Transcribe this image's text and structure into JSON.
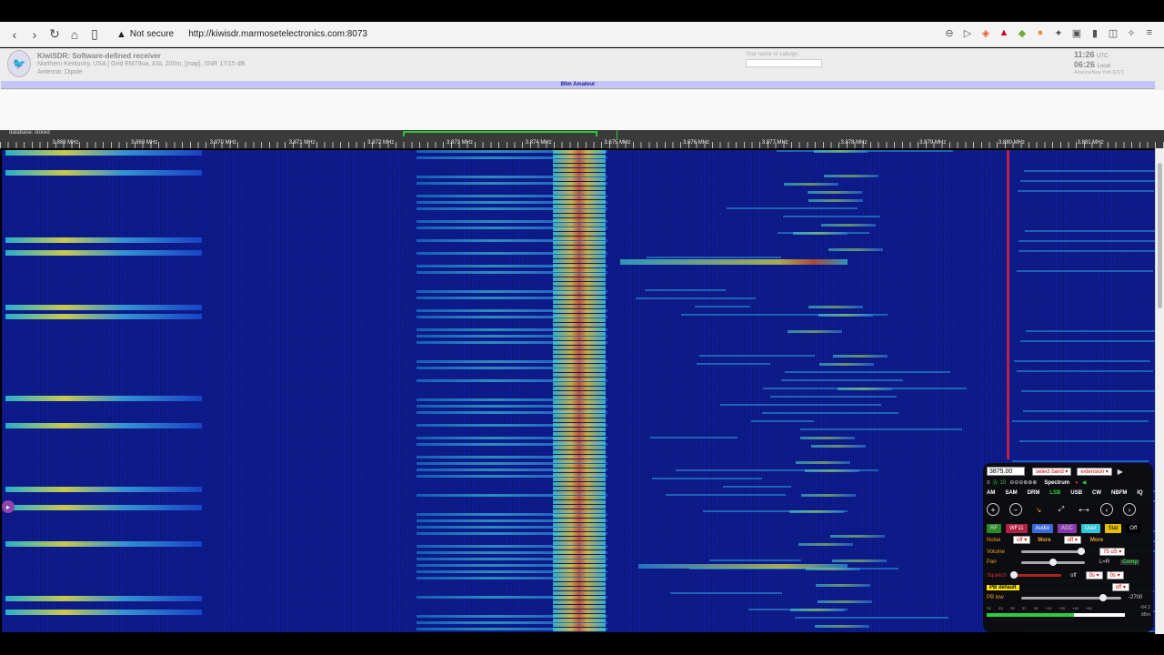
{
  "browser": {
    "security_label": "Not secure",
    "url": "http://kiwisdr.marmosetelectronics.com:8073"
  },
  "header": {
    "title": "KiwiSDR: Software-defined receiver",
    "location": "Northern Kentucky, USA | Grid EM79ua, ASL 200m, [map], SNR 17/15 dB",
    "antenna": "Antenna: Dipole",
    "callsign_label": "Your name or callsign:",
    "callsign_value": "",
    "utc_time": "11:26",
    "utc_label": "UTC",
    "local_time": "06:26",
    "local_label": "Local",
    "timezone": "America/New York (EST)"
  },
  "band": {
    "name": "80m Amateur"
  },
  "scale": {
    "database_label": "database: stored",
    "freqs": [
      "3.868 MHz",
      "3.869 MHz",
      "3.870 MHz",
      "3.871 MHz",
      "3.872 MHz",
      "3.873 MHz",
      "3.874 MHz",
      "3.875 MHz",
      "3.876 MHz",
      "3.877 MHz",
      "3.878 MHz",
      "3.879 MHz",
      "3.880 MHz",
      "3.881 MHz"
    ]
  },
  "panel": {
    "frequency": "3875.00",
    "band_select": "select band",
    "extension_select": "extension",
    "spectrum_label": "Spectrum",
    "zoom_level": "10",
    "modes": [
      "AM",
      "SAM",
      "DRM",
      "LSB",
      "USB",
      "CW",
      "NBFM",
      "IQ"
    ],
    "active_mode": "LSB",
    "tabs": [
      "RF",
      "WF11",
      "Audio",
      "AGC",
      "User",
      "Stat",
      "Off"
    ],
    "noise_label": "Noise",
    "noise_value": "off",
    "noise_value2": "off",
    "more_label": "More",
    "volume_label": "Volume",
    "volume_unit": "75 uS",
    "pan_label": "Pan",
    "pan_lr": "L=R",
    "comp_label": "Comp",
    "squelch_label": "Squelch",
    "squelch_off": "off",
    "squelch_value": "0s",
    "squelch_value2": "0s",
    "pb_default": "PB default",
    "pb_off": "off",
    "pb_low_label": "PB low",
    "pb_low_value": "-2700",
    "smeter_ticks": [
      "S1",
      "S3",
      "S5",
      "S7",
      "S9",
      "+10",
      "+20",
      "+40",
      "+60"
    ],
    "smeter_value": "-64.2",
    "smeter_unit": "dBm"
  }
}
